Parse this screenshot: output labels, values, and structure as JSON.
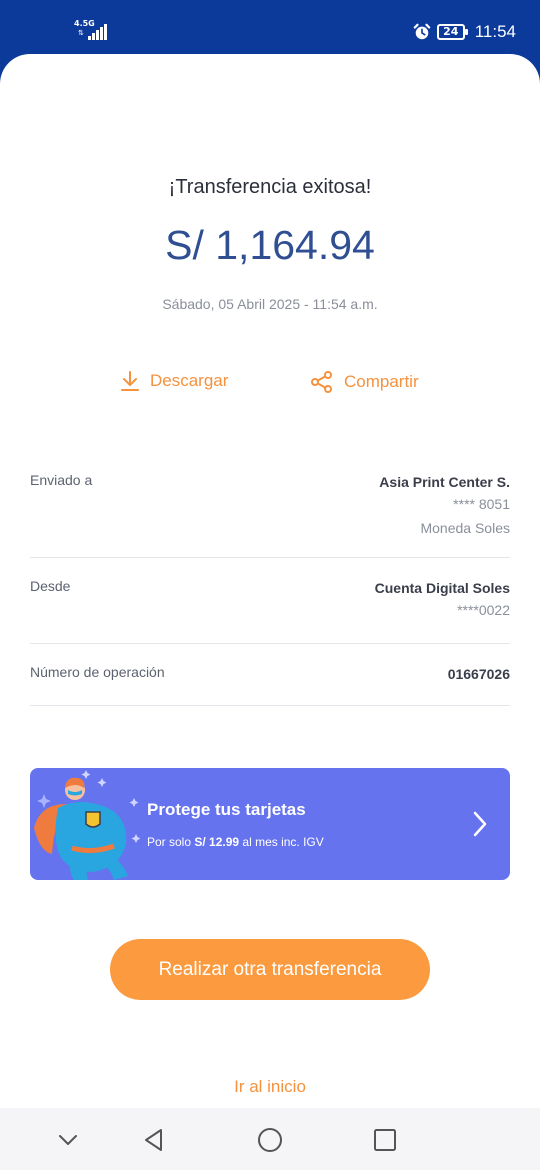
{
  "status_bar": {
    "network": "4.5G",
    "battery": "24",
    "time": "11:54"
  },
  "receipt": {
    "title": "¡Transferencia exitosa!",
    "amount": "S/ 1,164.94",
    "datetime": "Sábado, 05 Abril 2025 - 11:54 a.m."
  },
  "actions": {
    "download_label": "Descargar",
    "share_label": "Compartir"
  },
  "details": {
    "sent_to": {
      "label": "Enviado a",
      "name": "Asia Print Center S.",
      "account": "**** 8051",
      "currency": "Moneda Soles"
    },
    "from": {
      "label": "Desde",
      "account_name": "Cuenta Digital Soles",
      "account": "****0022"
    },
    "operation": {
      "label": "Número de operación",
      "number": "01667026"
    }
  },
  "promo": {
    "title": "Protege tus tarjetas",
    "subtitle_prefix": "Por solo ",
    "price": "S/ 12.99",
    "subtitle_suffix": " al mes inc. IGV",
    "background_color": "#6673ee"
  },
  "buttons": {
    "repeat_transfer": "Realizar otra transferencia",
    "go_home": "Ir al inicio"
  },
  "colors": {
    "brand_blue": "#0b3a9a",
    "accent_orange": "#f5923e",
    "amount_blue": "#2f4f92"
  }
}
